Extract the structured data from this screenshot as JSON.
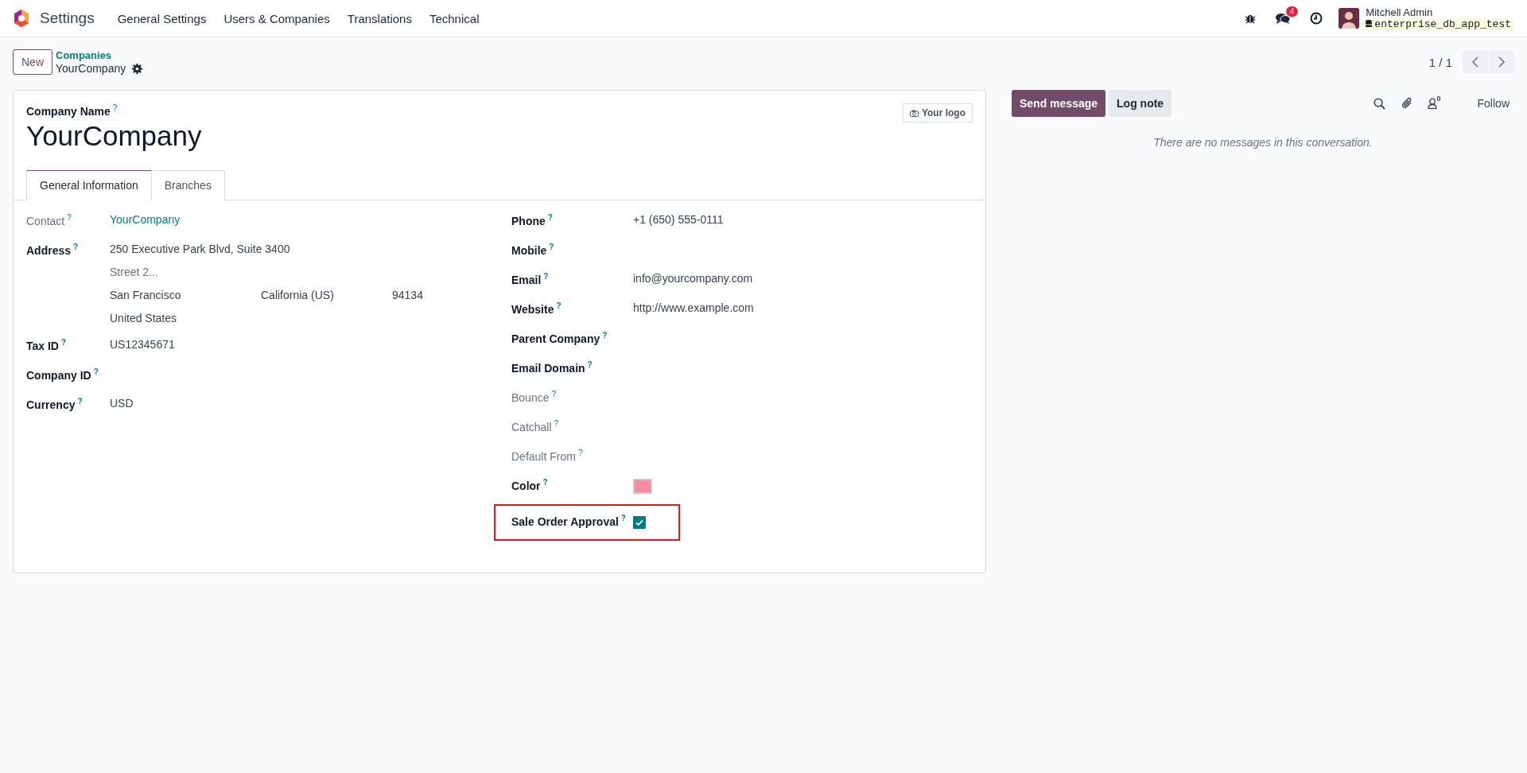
{
  "navbar": {
    "app": "Settings",
    "menus": [
      {
        "label": "General Settings"
      },
      {
        "label": "Users & Companies"
      },
      {
        "label": "Translations"
      },
      {
        "label": "Technical"
      }
    ],
    "message_count": "4",
    "user": {
      "name": "Mitchell Admin",
      "database": "enterprise_db_app_test"
    }
  },
  "control_panel": {
    "new_button": "New",
    "breadcrumb": "Companies",
    "record": "YourCompany",
    "pager": "1 / 1"
  },
  "form": {
    "name_label": "Company Name",
    "name_help": "?",
    "name": "YourCompany",
    "logo_button": "Your logo",
    "tabs": [
      {
        "label": "General Information",
        "selected": true
      },
      {
        "label": "Branches",
        "selected": false
      }
    ],
    "left_fields": [
      {
        "label": "Contact",
        "help": "?",
        "muted": true,
        "kind": "link",
        "value": "YourCompany"
      },
      {
        "label": "Address",
        "help": "?",
        "muted": false,
        "kind": "address",
        "street": "250 Executive Park Blvd, Suite 3400",
        "street2_placeholder": "Street 2...",
        "city": "San Francisco",
        "state": "California (US)",
        "zip": "94134",
        "country": "United States"
      },
      {
        "label": "Tax ID",
        "help": "?",
        "muted": false,
        "kind": "text",
        "value": "US12345671"
      },
      {
        "label": "Company ID",
        "help": "?",
        "muted": false,
        "kind": "text"
      },
      {
        "label": "Currency",
        "help": "?",
        "muted": false,
        "kind": "text",
        "value": "USD"
      }
    ],
    "right_fields": [
      {
        "label": "Phone",
        "help": "?",
        "muted": false,
        "kind": "text",
        "value": "+1 (650) 555-0111"
      },
      {
        "label": "Mobile",
        "help": "?",
        "muted": false,
        "kind": "text"
      },
      {
        "label": "Email",
        "help": "?",
        "muted": false,
        "kind": "text",
        "value": "info@yourcompany.com"
      },
      {
        "label": "Website",
        "help": "?",
        "muted": false,
        "kind": "text",
        "value": "http://www.example.com"
      },
      {
        "label": "Parent Company",
        "help": "?",
        "muted": false,
        "kind": "text"
      },
      {
        "label": "Email Domain",
        "help": "?",
        "muted": false,
        "kind": "text"
      },
      {
        "label": "Bounce",
        "help": "?",
        "muted": true,
        "kind": "text"
      },
      {
        "label": "Catchall",
        "help": "?",
        "muted": true,
        "kind": "text"
      },
      {
        "label": "Default From",
        "help": "?",
        "muted": true,
        "kind": "text"
      },
      {
        "label": "Color",
        "help": "?",
        "muted": false,
        "kind": "color",
        "color": "#f48c9c"
      },
      {
        "label": "Sale Order Approval",
        "help": "?",
        "muted": false,
        "kind": "checkbox",
        "checked": true,
        "highlighted": true
      }
    ]
  },
  "chatter": {
    "send_button": "Send message",
    "log_button": "Log note",
    "followers_count": "0",
    "follow_button": "Follow",
    "empty_message": "There are no messages in this conversation."
  }
}
